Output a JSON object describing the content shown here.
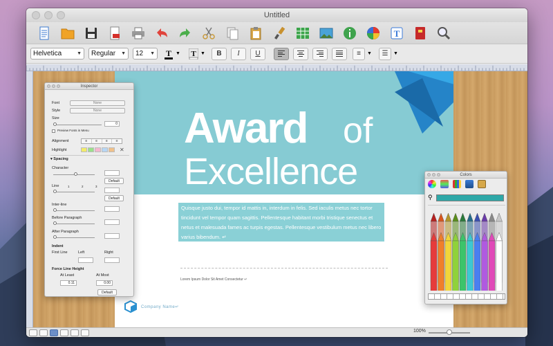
{
  "window": {
    "title": "Untitled"
  },
  "toolbar": {
    "icons": [
      "document-icon",
      "folder-icon",
      "save-icon",
      "pdf-icon",
      "print-icon",
      "undo-icon",
      "redo-icon",
      "cut-icon",
      "copy-icon",
      "paste-icon",
      "format-brush-icon",
      "table-icon",
      "image-icon",
      "info-icon",
      "color-wheel-icon",
      "text-style-icon",
      "book-icon",
      "zoom-icon"
    ]
  },
  "format": {
    "font": "Helvetica",
    "style": "Regular",
    "size": "12",
    "bold": "B",
    "italic": "I",
    "underline": "U"
  },
  "document": {
    "heading_award": "Award",
    "heading_of": "of",
    "heading_excellence": "Excellence",
    "body_text": "Quisque justo dui, tempor id mattis in, interdum in felis. Sed iaculis metus nec tortor tincidunt vel tempor quam sagittis. Pellentesque habitant morbi tristique senectus et netus et malesuada fames ac turpis egestas. Pellentesque vestibulum metus nec libero varius bibendum. ↵",
    "footer_line": "Lorem Ipsum Dolor Sit Amet Consectetur ↵",
    "company_name": "Company Name↵",
    "colors": {
      "banner": "#86cbd3",
      "highlight": "#8ad0d6",
      "accent_blue": "#1e8fd8"
    }
  },
  "status": {
    "zoom": "100%"
  },
  "inspector": {
    "title": "Inspector",
    "font_label": "Font",
    "font_value": "None",
    "style_label": "Style",
    "style_value": "None",
    "size_label": "Size",
    "size_value": "0",
    "preview_fonts": "Preview Fonts in Menu",
    "alignment_label": "Alignment",
    "highlight_label": "Highlight",
    "spacing_label": "Spacing",
    "character_label": "Character",
    "default_label": "Default",
    "line_label": "Line",
    "line_ticks": [
      "1",
      "2",
      "3"
    ],
    "interline_label": "Inter-line",
    "before_paragraph_label": "Before Paragraph",
    "after_paragraph_label": "After Paragraph",
    "indent_label": "Indent",
    "first_line_label": "First Line",
    "left_label": "Left",
    "right_label": "Right",
    "force_line_height_label": "Force Line Height",
    "at_least_label": "At Least",
    "at_most_label": "At Most",
    "at_least_value": "0.11",
    "at_most_value": "0.00",
    "highlight_swatches": [
      "#f3ec6b",
      "#9be08a",
      "#f5b8d0",
      "#b7d7f5",
      "#f0c18a"
    ]
  },
  "colors_panel": {
    "title": "Colors",
    "selected_color": "#2ea8a8"
  }
}
